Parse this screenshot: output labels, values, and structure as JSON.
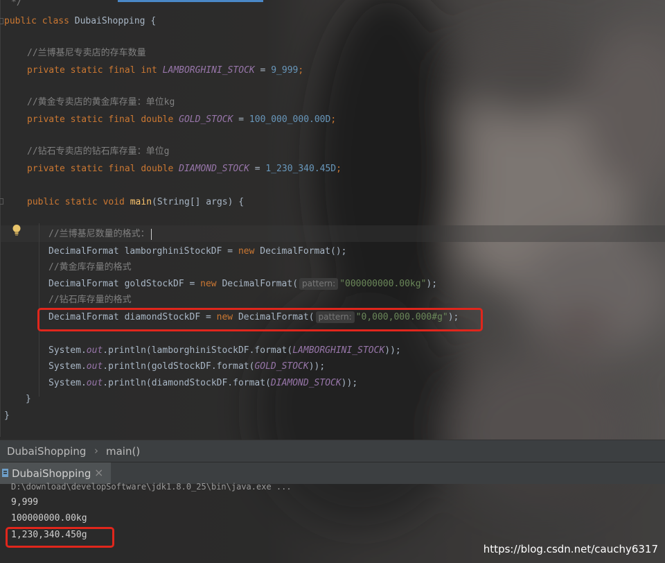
{
  "editor": {
    "top_fragment": "*/",
    "lines": {
      "class_decl": {
        "kw": "public class ",
        "name": "DubaiShopping {"
      },
      "cmt1": "//兰博基尼专卖店的存车数量",
      "field1": {
        "kw": "private static final int ",
        "name": "LAMBORGHINI_STOCK",
        "eq": " = ",
        "val": "9_999",
        "end": ";"
      },
      "cmt2": "//黄金专卖店的黄金库存量：单位kg",
      "field2": {
        "kw": "private static final double ",
        "name": "GOLD_STOCK",
        "eq": " = ",
        "val": "100_000_000.00D",
        "end": ";"
      },
      "cmt3": "//钻石专卖店的钻石库存量：单位g",
      "field3": {
        "kw": "private static final double ",
        "name": "DIAMOND_STOCK",
        "eq": " = ",
        "val": "1_230_340.45D",
        "end": ";"
      },
      "main_decl": {
        "kw": "public static void ",
        "fn": "main",
        "rest": "(String[] args) {"
      },
      "cmt4": "//兰博基尼数量的格式：",
      "l1": {
        "a": "DecimalFormat lamborghiniStockDF = ",
        "kw": "new ",
        "b": "DecimalFormat();"
      },
      "cmt5": "//黄金库存量的格式",
      "l2": {
        "a": "DecimalFormat goldStockDF = ",
        "kw": "new ",
        "b": "DecimalFormat(",
        "hint": "pattern:",
        "str": "\"000000000.00kg\"",
        "end": ");"
      },
      "cmt6": "//钻石库存量的格式",
      "l3": {
        "a": "DecimalFormat diamondStockDF = ",
        "kw": "new ",
        "b": "DecimalFormat(",
        "hint": "pattern:",
        "str": "\"0,000,000.000#g\"",
        "end": ");"
      },
      "p1": {
        "a": "System.",
        "out": "out",
        "b": ".println(lamborghiniStockDF.format(",
        "c": "LAMBORGHINI_STOCK",
        "d": "));"
      },
      "p2": {
        "a": "System.",
        "out": "out",
        "b": ".println(goldStockDF.format(",
        "c": "GOLD_STOCK",
        "d": "));"
      },
      "p3": {
        "a": "System.",
        "out": "out",
        "b": ".println(diamondStockDF.format(",
        "c": "DIAMOND_STOCK",
        "d": "));"
      },
      "close_method": "}",
      "close_class": "}"
    }
  },
  "breadcrumb": {
    "class": "DubaiShopping",
    "sep": "›",
    "method": "main()"
  },
  "run_panel": {
    "tab_label": "DubaiShopping",
    "tab_close": "×",
    "command": "D:\\download\\developSoftware\\jdk1.8.0_25\\bin\\java.exe ...",
    "outputs": [
      "9,999",
      "100000000.00kg",
      "1,230,340.450g"
    ]
  },
  "watermark": "https://blog.csdn.net/cauchy6317",
  "colors": {
    "highlight_box": "#e0261c",
    "keyword": "#cc7832",
    "constant": "#9876aa",
    "string": "#6a8759",
    "comment": "#808080"
  }
}
